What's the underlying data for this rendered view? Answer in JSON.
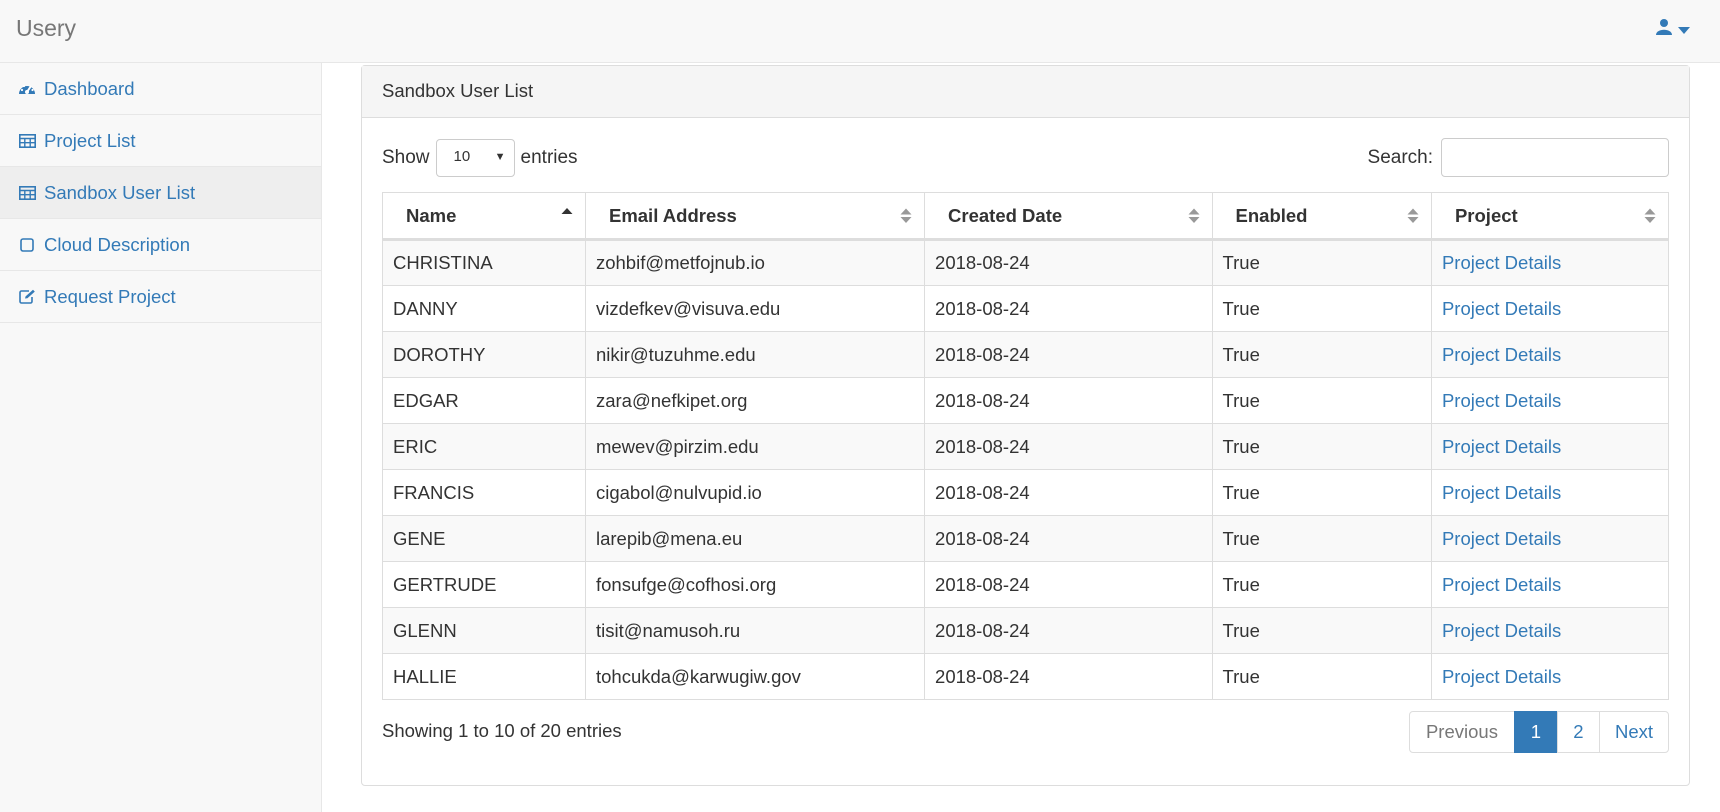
{
  "app": {
    "title": "Usery"
  },
  "colors": {
    "accent": "#337ab7",
    "muted": "#777777",
    "border": "#dddddd"
  },
  "user_menu": {
    "icon": "user-icon",
    "caret": "caret-down-icon"
  },
  "sidebar": {
    "items": [
      {
        "label": "Dashboard",
        "icon": "dashboard-icon",
        "active": false
      },
      {
        "label": "Project List",
        "icon": "table-icon",
        "active": false
      },
      {
        "label": "Sandbox User List",
        "icon": "table-icon",
        "active": true
      },
      {
        "label": "Cloud Description",
        "icon": "square-icon",
        "active": false
      },
      {
        "label": "Request Project",
        "icon": "edit-icon",
        "active": false
      }
    ]
  },
  "panel": {
    "title": "Sandbox User List"
  },
  "length": {
    "show_label": "Show",
    "value": "10",
    "entries_label": "entries"
  },
  "search": {
    "label": "Search:",
    "value": ""
  },
  "table": {
    "columns": [
      "Name",
      "Email Address",
      "Created Date",
      "Enabled",
      "Project"
    ],
    "sorted_column": "Name",
    "sort_direction": "ascending",
    "rows": [
      [
        "CHRISTINA",
        "zohbif@metfojnub.io",
        "2018-08-24",
        "True",
        "Project Details"
      ],
      [
        "DANNY",
        "vizdefkev@visuva.edu",
        "2018-08-24",
        "True",
        "Project Details"
      ],
      [
        "DOROTHY",
        "nikir@tuzuhme.edu",
        "2018-08-24",
        "True",
        "Project Details"
      ],
      [
        "EDGAR",
        "zara@nefkipet.org",
        "2018-08-24",
        "True",
        "Project Details"
      ],
      [
        "ERIC",
        "mewev@pirzim.edu",
        "2018-08-24",
        "True",
        "Project Details"
      ],
      [
        "FRANCIS",
        "cigabol@nulvupid.io",
        "2018-08-24",
        "True",
        "Project Details"
      ],
      [
        "GENE",
        "larepib@mena.eu",
        "2018-08-24",
        "True",
        "Project Details"
      ],
      [
        "GERTRUDE",
        "fonsufge@cofhosi.org",
        "2018-08-24",
        "True",
        "Project Details"
      ],
      [
        "GLENN",
        "tisit@namusoh.ru",
        "2018-08-24",
        "True",
        "Project Details"
      ],
      [
        "HALLIE",
        "tohcukda@karwugiw.gov",
        "2018-08-24",
        "True",
        "Project Details"
      ]
    ]
  },
  "footer": {
    "info": "Showing 1 to 10 of 20 entries",
    "pagination": {
      "previous": "Previous",
      "pages": [
        "1",
        "2"
      ],
      "current": "1",
      "next": "Next"
    }
  }
}
